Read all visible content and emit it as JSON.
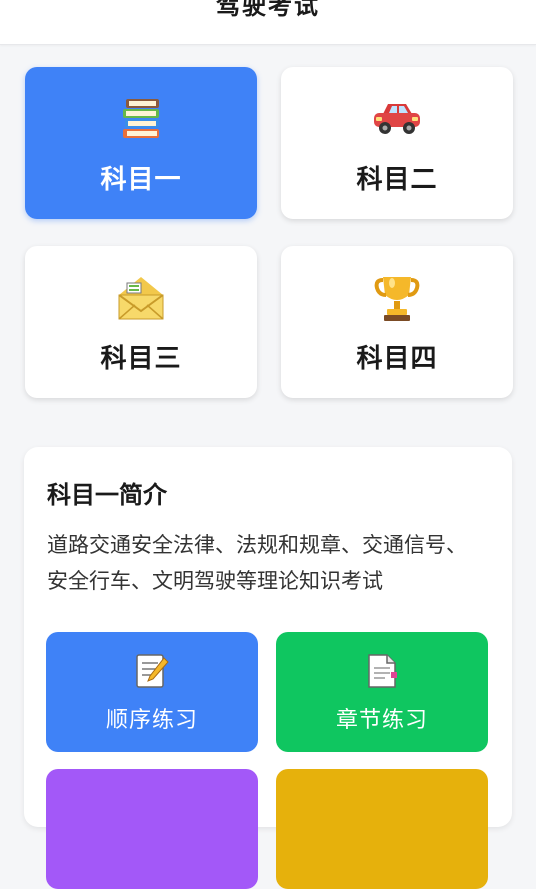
{
  "header": {
    "title": "驾驶考试"
  },
  "subjects": [
    {
      "label": "科目一",
      "icon": "books-icon",
      "active": true
    },
    {
      "label": "科目二",
      "icon": "car-icon",
      "active": false
    },
    {
      "label": "科目三",
      "icon": "envelope-icon",
      "active": false
    },
    {
      "label": "科目四",
      "icon": "trophy-icon",
      "active": false
    }
  ],
  "intro": {
    "title": "科目一简介",
    "description": "道路交通安全法律、法规和规章、交通信号、安全行车、文明驾驶等理论知识考试"
  },
  "practice": [
    {
      "label": "顺序练习",
      "icon": "memo-icon",
      "color": "#3f82f7"
    },
    {
      "label": "章节练习",
      "icon": "document-icon",
      "color": "#0fc660"
    },
    {
      "label": "",
      "icon": "",
      "color": "#a358f8"
    },
    {
      "label": "",
      "icon": "",
      "color": "#e6b10c"
    }
  ],
  "colors": {
    "accent": "#3f82f7",
    "background": "#f5f6f8"
  }
}
